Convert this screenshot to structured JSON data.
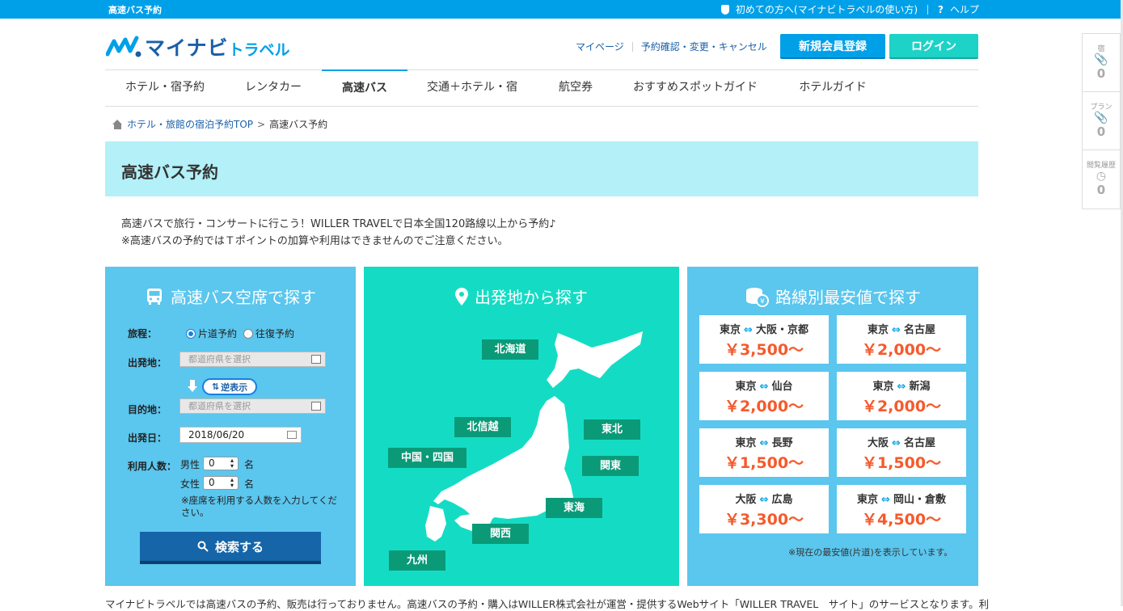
{
  "topbar": {
    "brand": "高速バス予約",
    "first_time": "初めての方へ(マイナビトラベルの使い方)",
    "help": "ヘルプ"
  },
  "header": {
    "logo_main": "マイナビ",
    "logo_sub": "トラベル",
    "mypage": "マイページ",
    "reservation": "予約確認・変更・キャンセル",
    "register": "新規会員登録",
    "login": "ログイン"
  },
  "nav": {
    "items": [
      "ホテル・宿予約",
      "レンタカー",
      "高速バス",
      "交通＋ホテル・宿",
      "航空券",
      "おすすめスポットガイド",
      "ホテルガイド"
    ],
    "active_index": 2
  },
  "breadcrumb": {
    "home": "ホテル・旅館の宿泊予約TOP",
    "sep": ">",
    "current": "高速バス予約"
  },
  "page_title": "高速バス予約",
  "intro": {
    "line1": "高速バスで旅行・コンサートに行こう！WILLER TRAVELで日本全国120路線以上から予約♪",
    "line2": "※高速バスの予約ではＴポイントの加算や利用はできませんのでご注意ください。"
  },
  "search_panel": {
    "title": "高速バス空席で探す",
    "trip_label": "旅程：",
    "oneway": "片道予約",
    "roundtrip": "往復予約",
    "trip_selected": "oneway",
    "from_label": "出発地：",
    "from_placeholder": "都道府県を選択",
    "swap_label": "逆表示",
    "to_label": "目的地：",
    "to_placeholder": "都道府県を選択",
    "date_label": "出発日：",
    "date_value": "2018/06/20",
    "people_label": "利用人数：",
    "male_label": "男性",
    "male_value": "0",
    "female_label": "女性",
    "female_value": "0",
    "unit": "名",
    "note": "※座席を利用する人数を入力してください。",
    "search_button": "検索する"
  },
  "map_panel": {
    "title": "出発地から探す",
    "regions": {
      "hokkaido": "北海道",
      "tohoku": "東北",
      "kitashinetsu": "北信越",
      "kanto": "関東",
      "chugoku": "中国・四国",
      "tokai": "東海",
      "kansai": "関西",
      "kyushu": "九州"
    }
  },
  "price_panel": {
    "title": "路線別最安値で探す",
    "arrow": "⇔",
    "routes": [
      {
        "from": "東京",
        "to": "大阪・京都",
        "price": "￥3,500〜"
      },
      {
        "from": "東京",
        "to": "名古屋",
        "price": "￥2,000〜"
      },
      {
        "from": "東京",
        "to": "仙台",
        "price": "￥2,000〜"
      },
      {
        "from": "東京",
        "to": "新潟",
        "price": "￥2,000〜"
      },
      {
        "from": "東京",
        "to": "長野",
        "price": "￥1,500〜"
      },
      {
        "from": "大阪",
        "to": "名古屋",
        "price": "￥1,500〜"
      },
      {
        "from": "大阪",
        "to": "広島",
        "price": "￥3,300〜"
      },
      {
        "from": "東京",
        "to": "岡山・倉敷",
        "price": "￥4,500〜"
      }
    ],
    "note": "※現在の最安値(片道)を表示しています。"
  },
  "footer_note": "マイナビトラベルでは高速バスの予約、販売は行っておりません。高速バスの予約・購入はWILLER株式会社が運営・提供するWebサイト「WILLER TRAVEL　サイト」のサービスとなります。利",
  "side_widget": {
    "items": [
      {
        "label": "宿",
        "icon": "paperclip-icon",
        "count": "0"
      },
      {
        "label": "プラン",
        "icon": "paperclip-icon",
        "count": "0"
      },
      {
        "label": "閲覧履歴",
        "icon": "clock-icon",
        "count": "0"
      }
    ]
  },
  "colors": {
    "brand_blue": "#00a0e9",
    "teal": "#14dcc4",
    "light_blue": "#5bc6ee",
    "price_orange": "#f55a2c"
  }
}
